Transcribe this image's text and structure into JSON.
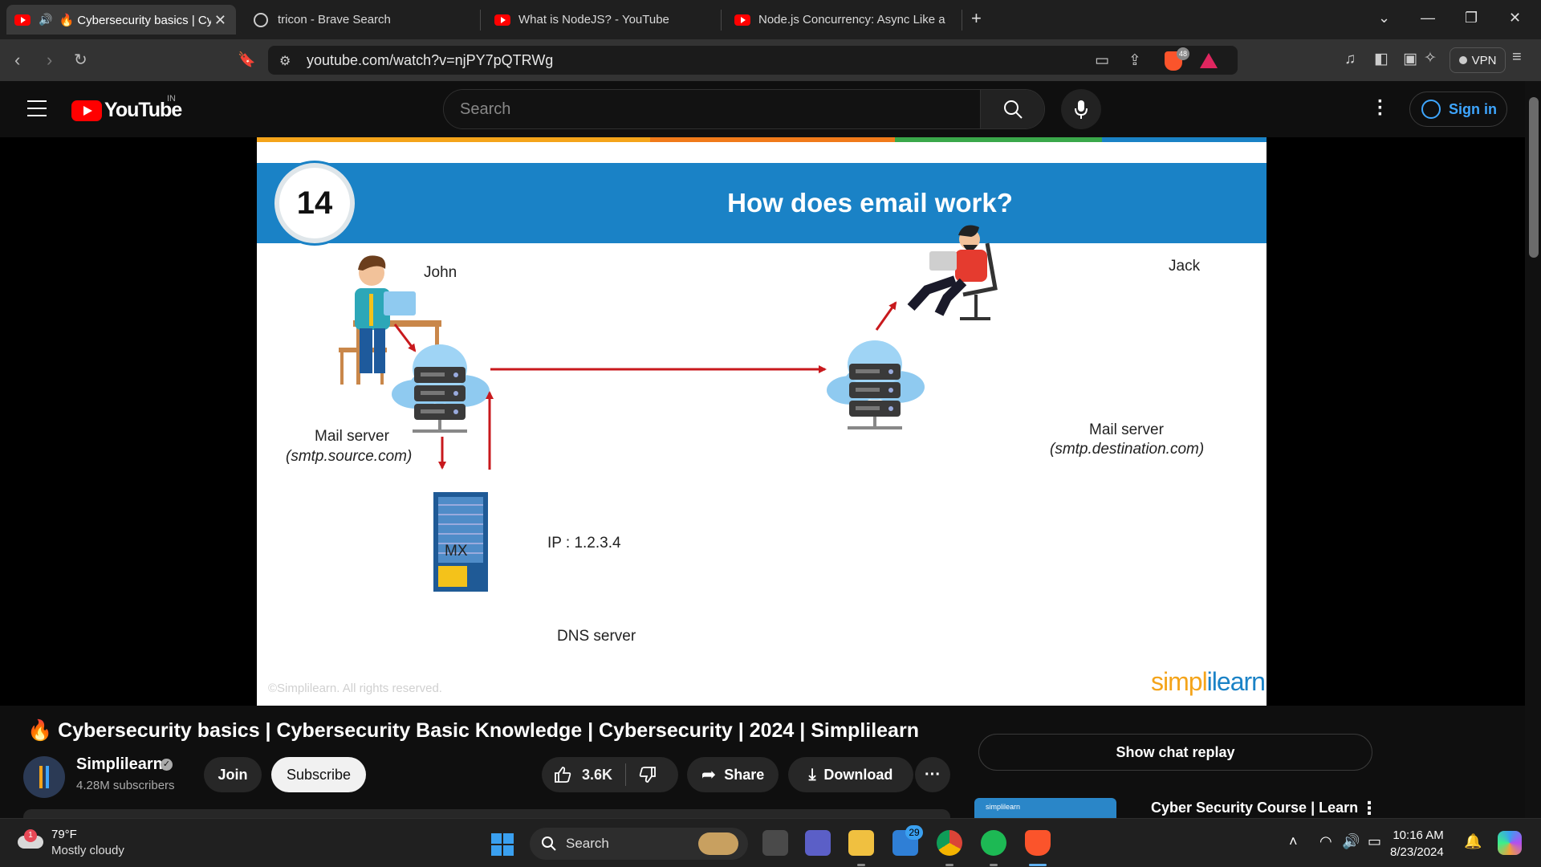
{
  "browser": {
    "tabs": [
      {
        "title": "🔥 Cybersecurity basics | Cyb",
        "active": true
      },
      {
        "title": "tricon - Brave Search",
        "active": false
      },
      {
        "title": "What is NodeJS? - YouTube",
        "active": false
      },
      {
        "title": "Node.js Concurrency: Async Like a B",
        "active": false
      }
    ],
    "url": "youtube.com/watch?v=njPY7pQTRWg",
    "brave_shield_count": "48",
    "vpn_label": "VPN"
  },
  "youtube": {
    "logo_text": "YouTube",
    "region": "IN",
    "search_placeholder": "Search",
    "sign_in_label": "Sign in"
  },
  "slide": {
    "number": "14",
    "title": "How does email work?",
    "sender": "John",
    "receiver": "Jack",
    "source_server_label": "Mail server",
    "source_server_host": "(smtp.source.com)",
    "dest_server_label": "Mail server",
    "dest_server_host": "(smtp.destination.com)",
    "mx_label": "MX",
    "ip_label": "IP : 1.2.3.4",
    "dns_label": "DNS server",
    "copyright": "©Simplilearn. All rights reserved.",
    "brand_left": "simpl",
    "brand_right": "ilearn",
    "colors": {
      "header": "#1a82c6",
      "arrow": "#c8191d",
      "cloud": "#8fcaf0",
      "server": "#3a3a3a"
    }
  },
  "video": {
    "title": "🔥 Cybersecurity basics | Cybersecurity Basic Knowledge | Cybersecurity | 2024 | Simplilearn",
    "channel": "Simplilearn",
    "subscribers": "4.28M subscribers",
    "join_label": "Join",
    "subscribe_label": "Subscribe",
    "likes": "3.6K",
    "share_label": "Share",
    "download_label": "Download",
    "more_label": "···"
  },
  "sidebar": {
    "chat_replay_label": "Show chat replay",
    "recommendation_title": "Cyber Security Course | Learn",
    "recommendation_thumb_text": "simplilearn"
  },
  "taskbar": {
    "weather_badge": "1",
    "temperature": "79°F",
    "condition": "Mostly cloudy",
    "search_label": "Search",
    "mail_badge": "29",
    "time": "10:16 AM",
    "date": "8/23/2024"
  }
}
